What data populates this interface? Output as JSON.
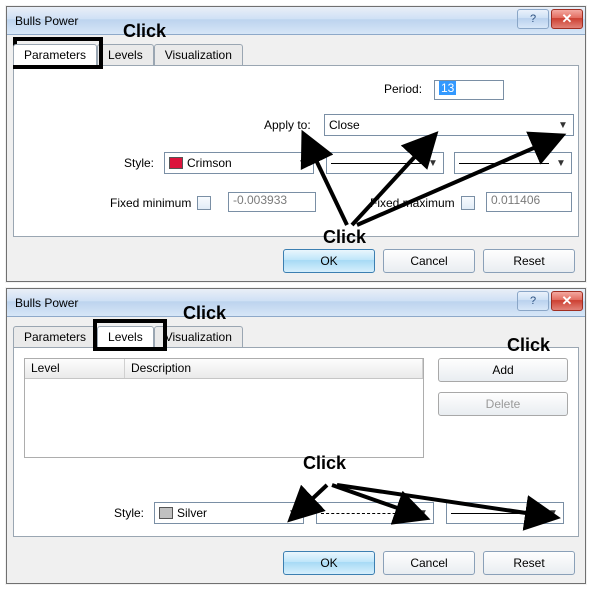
{
  "dialog1": {
    "title": "Bulls Power",
    "tabs": {
      "parameters": "Parameters",
      "levels": "Levels",
      "visualization": "Visualization"
    },
    "period_label": "Period:",
    "period_value": "13",
    "apply_label": "Apply to:",
    "apply_value": "Close",
    "style_label": "Style:",
    "style_color_name": "Crimson",
    "style_color_hex": "#DC143C",
    "fixmin_label": "Fixed minimum",
    "fixmin_value": "-0.003933",
    "fixmax_label": "Fixed maximum",
    "fixmax_value": "0.011406",
    "annotations": {
      "click_top": "Click",
      "click_mid": "Click"
    }
  },
  "dialog2": {
    "title": "Bulls Power",
    "tabs": {
      "parameters": "Parameters",
      "levels": "Levels",
      "visualization": "Visualization"
    },
    "list_headers": {
      "level": "Level",
      "description": "Description"
    },
    "add_label": "Add",
    "delete_label": "Delete",
    "style_label": "Style:",
    "style_color_name": "Silver",
    "style_color_hex": "#C0C0C0",
    "annotations": {
      "click_top": "Click",
      "click_add": "Click",
      "click_mid": "Click"
    }
  },
  "buttons": {
    "ok": "OK",
    "cancel": "Cancel",
    "reset": "Reset"
  }
}
